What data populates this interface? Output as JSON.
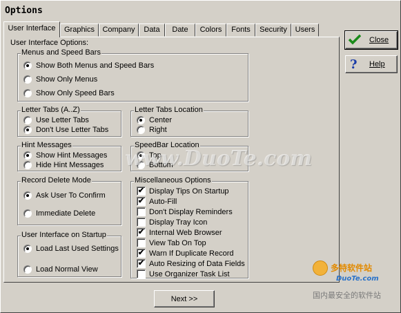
{
  "window": {
    "title": "Options"
  },
  "tabs": [
    {
      "label": "User Interface",
      "active": true
    },
    {
      "label": "Graphics"
    },
    {
      "label": "Company"
    },
    {
      "label": "Data"
    },
    {
      "label": "Date"
    },
    {
      "label": "Colors"
    },
    {
      "label": "Fonts"
    },
    {
      "label": "Security"
    },
    {
      "label": "Users"
    }
  ],
  "panel": {
    "title": "User Interface Options:",
    "menus": {
      "label": "Menus and Speed Bars",
      "options": [
        {
          "label": "Show Both Menus and Speed Bars",
          "selected": true
        },
        {
          "label": "Show Only Menus",
          "selected": false
        },
        {
          "label": "Show Only Speed Bars",
          "selected": false
        }
      ]
    },
    "letter_tabs": {
      "label": "Letter Tabs (A..Z)",
      "options": [
        {
          "label": "Use Letter Tabs",
          "selected": false
        },
        {
          "label": "Don't Use Letter Tabs",
          "selected": true
        }
      ]
    },
    "letter_tabs_location": {
      "label": "Letter Tabs Location",
      "options": [
        {
          "label": "Center",
          "selected": true
        },
        {
          "label": "Right",
          "selected": false
        }
      ]
    },
    "hint_messages": {
      "label": "Hint Messages",
      "options": [
        {
          "label": "Show Hint Messages",
          "selected": true
        },
        {
          "label": "Hide Hint Messages",
          "selected": false
        }
      ]
    },
    "speedbar_location": {
      "label": "SpeedBar Location",
      "options": [
        {
          "label": "Top",
          "selected": true
        },
        {
          "label": "Bottom",
          "selected": false
        }
      ]
    },
    "record_delete": {
      "label": "Record Delete Mode",
      "options": [
        {
          "label": "Ask User To Confirm",
          "selected": true
        },
        {
          "label": "Immediate Delete",
          "selected": false
        }
      ]
    },
    "startup": {
      "label": "User Interface on Startup",
      "options": [
        {
          "label": "Load Last Used Settings",
          "selected": true
        },
        {
          "label": "Load Normal View",
          "selected": false
        }
      ]
    },
    "misc": {
      "label": "Miscellaneous Options",
      "options": [
        {
          "label": "Display Tips On Startup",
          "checked": true
        },
        {
          "label": "Auto-Fill",
          "checked": true
        },
        {
          "label": "Don't Display Reminders",
          "checked": false
        },
        {
          "label": "Display Tray Icon",
          "checked": false
        },
        {
          "label": "Internal Web Browser",
          "checked": true
        },
        {
          "label": "View Tab On Top",
          "checked": false
        },
        {
          "label": "Warn If Duplicate Record",
          "checked": true
        },
        {
          "label": "Auto Resizing of Data Fields",
          "checked": true
        },
        {
          "label": "Use Organizer Task List",
          "checked": false
        }
      ]
    }
  },
  "buttons": {
    "close": "Close",
    "help": "Help",
    "next": "Next >>"
  },
  "watermark": {
    "text": "www.DuoTe.com",
    "logo_cn": "多特软件站",
    "logo_en": "DuoTe.com",
    "slogan": "国内最安全的软件站"
  }
}
